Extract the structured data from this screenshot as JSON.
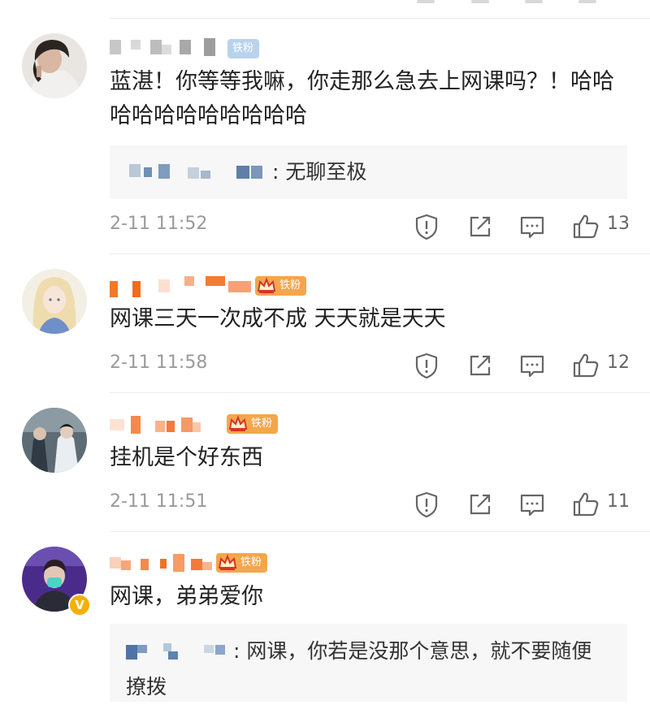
{
  "comments": [
    {
      "badge": "铁粉",
      "badge_style": "plain",
      "text": "蓝湛！你等等我嘛，你走那么急去上网课吗？！哈哈哈哈哈哈哈哈哈哈哈",
      "reply": {
        "colon": ":",
        "text": "无聊至极"
      },
      "time": "2-11 11:52",
      "likes": "13"
    },
    {
      "badge": "铁粉",
      "badge_style": "crown",
      "text": "网课三天一次成不成 天天就是天天",
      "time": "2-11 11:58",
      "likes": "12"
    },
    {
      "badge": "铁粉",
      "badge_style": "crown",
      "text": "挂机是个好东西",
      "time": "2-11 11:51",
      "likes": "11"
    },
    {
      "badge": "铁粉",
      "badge_style": "crown",
      "verified": "V",
      "text": "网课，弟弟爱你",
      "reply": {
        "colon": ":",
        "text": "网课，你若是没那个意思，就不要随便撩拨"
      }
    }
  ],
  "icons": {
    "report": "report-icon",
    "share": "share-icon",
    "comment": "comment-icon",
    "like": "like-icon"
  },
  "colors": {
    "badge_plain": "#b9d3ee",
    "badge_crown": "#f4a64c",
    "reply_bg": "#f7f7f7",
    "time": "#9a9a9a"
  }
}
